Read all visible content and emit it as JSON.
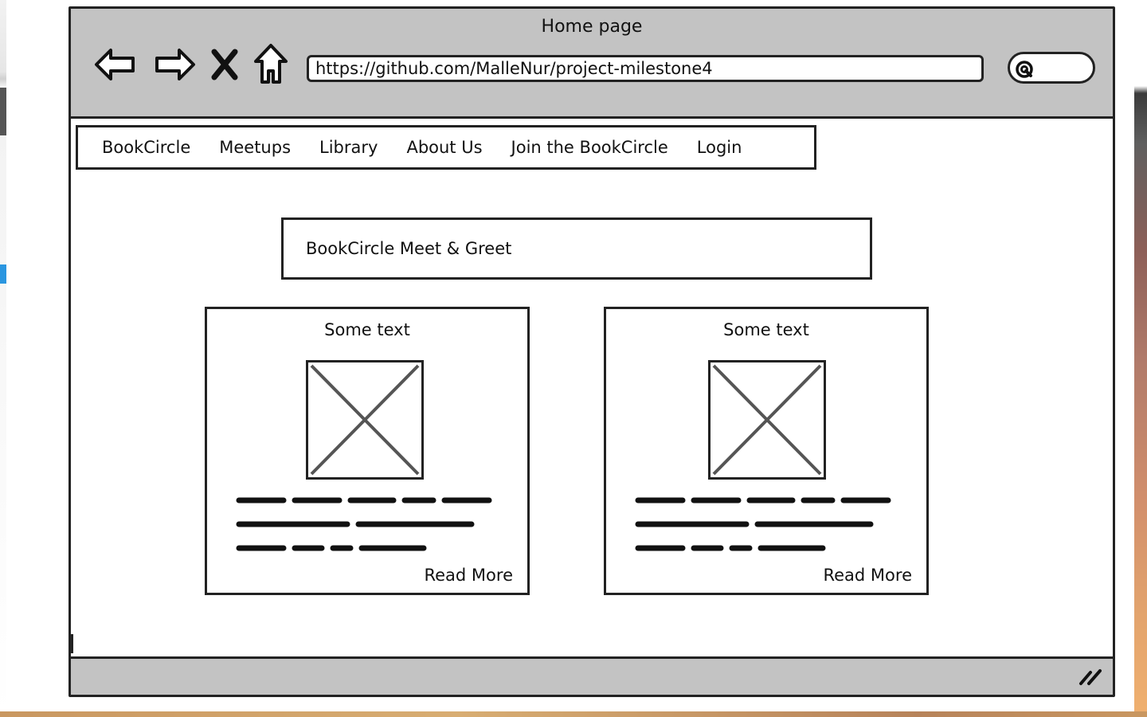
{
  "window": {
    "title": "Home page",
    "url": "https://github.com/MalleNur/project-milestone4",
    "icons": [
      "back-arrow-icon",
      "forward-arrow-icon",
      "close-x-icon",
      "home-icon",
      "search-icon",
      "resize-grip-icon"
    ]
  },
  "nav": {
    "items": [
      {
        "label": "BookCircle"
      },
      {
        "label": "Meetups"
      },
      {
        "label": "Library"
      },
      {
        "label": "About Us"
      },
      {
        "label": "Join the BookCircle"
      },
      {
        "label": "Login"
      }
    ]
  },
  "hero": {
    "title": "BookCircle Meet & Greet"
  },
  "cards": [
    {
      "title": "Some text",
      "cta": "Read More"
    },
    {
      "title": "Some text",
      "cta": "Read More"
    }
  ]
}
